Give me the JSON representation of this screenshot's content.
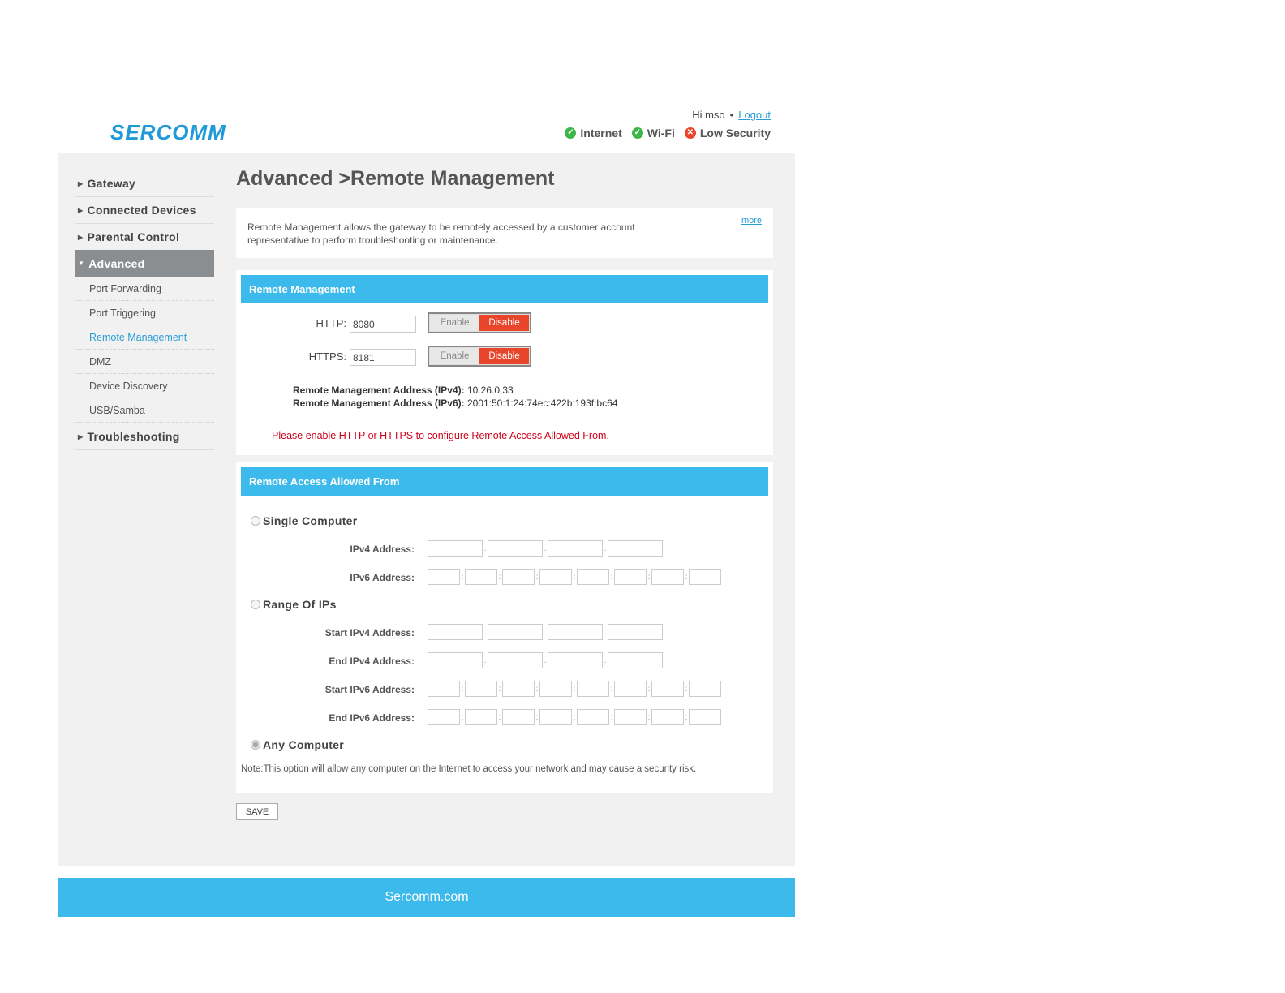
{
  "brand": {
    "logo_text": "SERCOMM",
    "logo_color": "#1f9ad6"
  },
  "header": {
    "greeting": "Hi mso",
    "separator": "•",
    "logout": "Logout",
    "status": [
      {
        "label": "Internet",
        "state": "ok",
        "icon": "check-circle-icon"
      },
      {
        "label": "Wi-Fi",
        "state": "ok",
        "icon": "check-circle-icon"
      },
      {
        "label": "Low Security",
        "state": "bad",
        "icon": "x-circle-icon"
      }
    ]
  },
  "sidebar": {
    "items": [
      {
        "label": "Gateway"
      },
      {
        "label": "Connected Devices"
      },
      {
        "label": "Parental Control"
      },
      {
        "label": "Advanced",
        "expanded": true
      },
      {
        "label": "Troubleshooting"
      }
    ],
    "advanced_sub": [
      {
        "label": "Port Forwarding"
      },
      {
        "label": "Port Triggering"
      },
      {
        "label": "Remote Management",
        "current": true
      },
      {
        "label": "DMZ"
      },
      {
        "label": "Device Discovery"
      },
      {
        "label": "USB/Samba"
      }
    ]
  },
  "main": {
    "title": "Advanced >Remote Management",
    "info": {
      "text": "Remote Management allows the gateway to be remotely accessed by a customer account representative to perform troubleshooting or maintenance.",
      "more": "more"
    },
    "remote_management": {
      "heading": "Remote Management",
      "http_label": "HTTP:",
      "http_port": "8080",
      "https_label": "HTTPS:",
      "https_port": "8181",
      "enable": "Enable",
      "disable": "Disable",
      "ipv4_label": "Remote Management Address (IPv4):",
      "ipv4_value": "10.26.0.33",
      "ipv6_label": "Remote Management Address (IPv6):",
      "ipv6_value": "2001:50:1:24:74ec:422b:193f:bc64",
      "warning": "Please enable HTTP or HTTPS to configure Remote Access Allowed From."
    },
    "remote_access": {
      "heading": "Remote Access Allowed From",
      "single": "Single Computer",
      "ipv4_address": "IPv4 Address:",
      "ipv6_address": "IPv6 Address:",
      "range": "Range Of IPs",
      "start_ipv4": "Start IPv4 Address:",
      "end_ipv4": "End IPv4 Address:",
      "start_ipv6": "Start IPv6 Address:",
      "end_ipv6": "End IPv6 Address:",
      "any": "Any Computer",
      "selected": "any",
      "note": "Note:This option will allow any computer on the Internet to access your network and may cause a security risk."
    },
    "save": "SAVE"
  },
  "footer": {
    "text": "Sercomm.com"
  },
  "colors": {
    "accent": "#3dbaec",
    "disable": "#e8452b",
    "warning": "#d0021b",
    "link": "#2a9fd6"
  }
}
